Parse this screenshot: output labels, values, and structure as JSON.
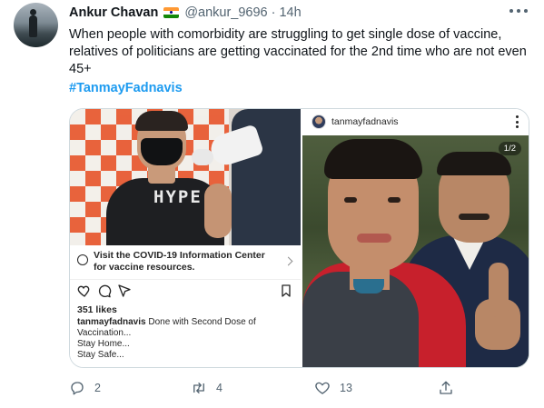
{
  "tweet": {
    "author_name": "Ankur Chavan",
    "author_handle": "@ankur_9696",
    "separator": "·",
    "time": "14h",
    "text": "When people with comorbidity are struggling to get single dose of vaccine, relatives of politicians are getting vaccinated for the 2nd time who are not even 45+",
    "hashtag": "#TanmayFadnavis",
    "flag_icon": "india-flag-icon"
  },
  "media": {
    "left": {
      "shirt_text": "HYPE",
      "info_banner": "Visit the COVID-19 Information Center for vaccine resources.",
      "likes": "351 likes",
      "caption_user": "tanmayfadnavis",
      "caption_text": " Done with Second Dose of Vaccination...",
      "caption_line2": "Stay Home...",
      "caption_line3": "Stay Safe..."
    },
    "right": {
      "username": "tanmayfadnavis",
      "counter": "1/2"
    }
  },
  "actions": {
    "reply_count": "2",
    "retweet_count": "4",
    "like_count": "13"
  },
  "colors": {
    "link": "#1d9bf0",
    "muted": "#536471",
    "border": "#cfd9de"
  }
}
